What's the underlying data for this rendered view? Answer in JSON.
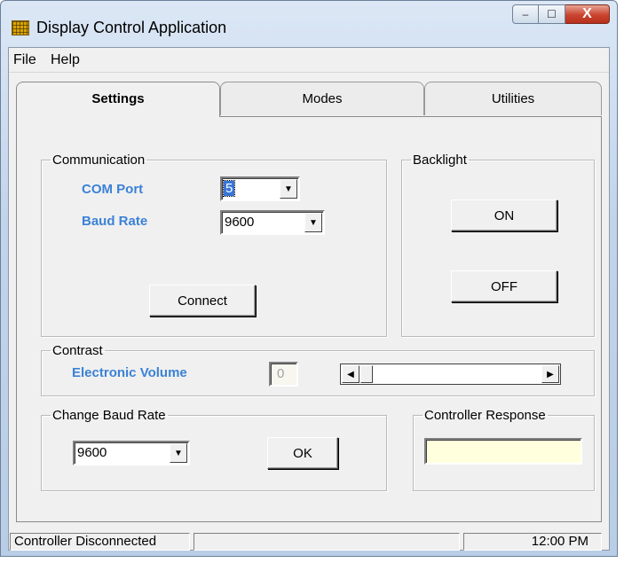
{
  "window": {
    "title": "Display Control Application",
    "caption_buttons": {
      "minimize": "–",
      "maximize": "☐",
      "close": "X"
    }
  },
  "menu": {
    "items": [
      "File",
      "Help"
    ]
  },
  "tabs": [
    {
      "label": "Settings",
      "active": true
    },
    {
      "label": "Modes",
      "active": false
    },
    {
      "label": "Utilities",
      "active": false
    }
  ],
  "communication": {
    "legend": "Communication",
    "com_port_label": "COM Port",
    "com_port_value": "5",
    "baud_rate_label": "Baud Rate",
    "baud_rate_value": "9600",
    "connect_button": "Connect"
  },
  "backlight": {
    "legend": "Backlight",
    "on_button": "ON",
    "off_button": "OFF"
  },
  "contrast": {
    "legend": "Contrast",
    "label": "Electronic Volume",
    "value": "0",
    "slider_level": 0
  },
  "change_baud": {
    "legend": "Change Baud Rate",
    "value": "9600",
    "ok_button": "OK"
  },
  "controller_response": {
    "legend": "Controller Response",
    "value": "",
    "field_color": "#ffffde"
  },
  "status": {
    "connection": "Controller Disconnected",
    "middle": "",
    "time": "12:00 PM"
  },
  "colors": {
    "label_blue": "#3b82d6",
    "dialog_bg": "#f0f0f0"
  },
  "icons": {
    "app": "led-grid-icon",
    "dropdown": "triangle-down-icon",
    "scroll_left": "triangle-left-icon",
    "scroll_right": "triangle-right-icon"
  }
}
